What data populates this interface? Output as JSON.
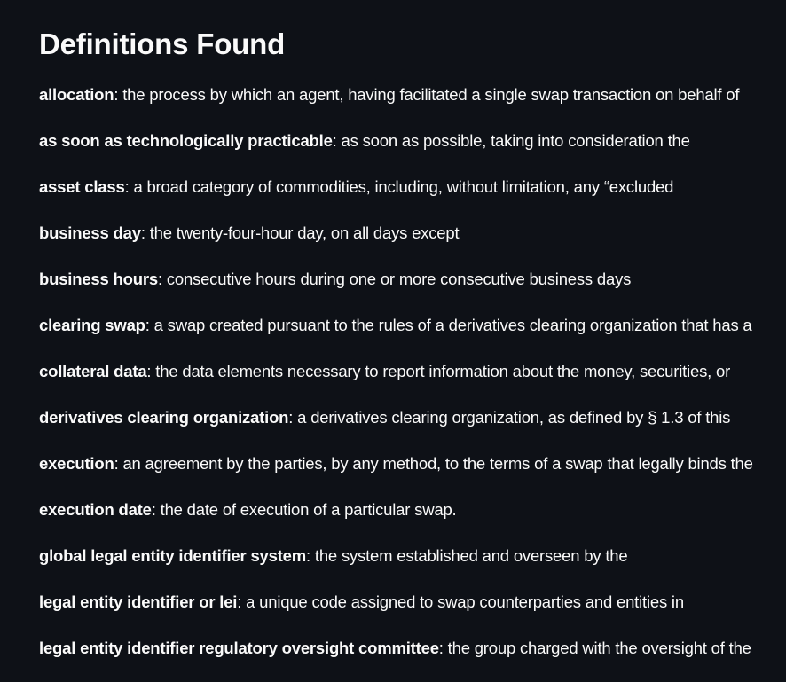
{
  "page": {
    "title": "Definitions Found"
  },
  "definitions": [
    {
      "term": "allocation",
      "text": ": the process by which an agent, having facilitated a single swap transaction on behalf of"
    },
    {
      "term": "as soon as technologically practicable",
      "text": ": as soon as possible, taking into consideration the"
    },
    {
      "term": "asset class",
      "text": ": a broad category of commodities, including, without limitation, any “excluded"
    },
    {
      "term": "business day",
      "text": ": the twenty-four-hour day, on all days except"
    },
    {
      "term": "business hours",
      "text": ": consecutive hours during one or more consecutive business days"
    },
    {
      "term": "clearing swap",
      "text": ": a swap created pursuant to the rules of a derivatives clearing organization that has a"
    },
    {
      "term": "collateral data",
      "text": ": the data elements necessary to report information about the money, securities, or"
    },
    {
      "term": "derivatives clearing organization",
      "text": ": a derivatives clearing organization, as defined by § 1.3 of this"
    },
    {
      "term": "execution",
      "text": ": an agreement by the parties, by any method, to the terms of a swap that legally binds the"
    },
    {
      "term": "execution date",
      "text": ": the date of execution of a particular swap."
    },
    {
      "term": "global legal entity identifier system",
      "text": ": the system established and overseen by the"
    },
    {
      "term": "legal entity identifier or lei",
      "text": ": a unique code assigned to swap counterparties and entities in"
    },
    {
      "term": "legal entity identifier regulatory oversight committee",
      "text": ": the group charged with the oversight of the"
    }
  ]
}
